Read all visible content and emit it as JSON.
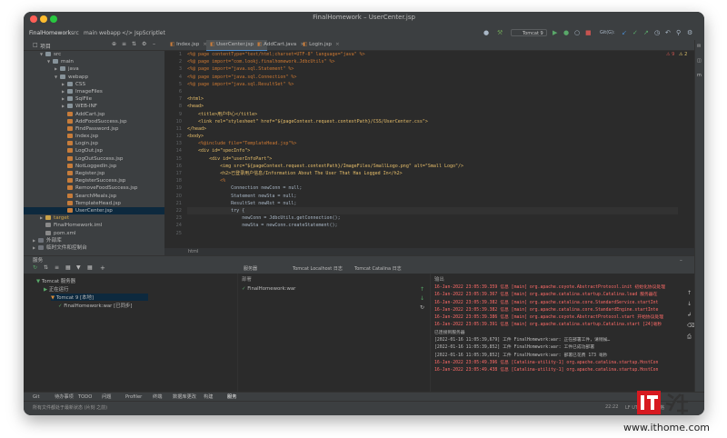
{
  "window": {
    "title": "FinalHomework – UserCenter.jsp"
  },
  "breadcrumb": [
    "FinalHomework",
    "src",
    "main",
    "webapp",
    "</> JspScriptlet"
  ],
  "run_config": "Tomcat 9",
  "project_panel": {
    "label": "项目"
  },
  "tree": [
    {
      "label": "src",
      "indent": 1,
      "kind": "folder",
      "open": true
    },
    {
      "label": "main",
      "indent": 2,
      "kind": "folder",
      "open": true
    },
    {
      "label": "java",
      "indent": 3,
      "kind": "folder",
      "open": false
    },
    {
      "label": "webapp",
      "indent": 3,
      "kind": "folder",
      "open": true
    },
    {
      "label": "CSS",
      "indent": 4,
      "kind": "folder",
      "open": false
    },
    {
      "label": "ImageFiles",
      "indent": 4,
      "kind": "folder",
      "open": false
    },
    {
      "label": "SqlFile",
      "indent": 4,
      "kind": "folder",
      "open": false
    },
    {
      "label": "WEB-INF",
      "indent": 4,
      "kind": "folder",
      "open": false
    },
    {
      "label": "AddCart.jsp",
      "indent": 4,
      "kind": "jsp"
    },
    {
      "label": "AddFoodSuccess.jsp",
      "indent": 4,
      "kind": "jsp"
    },
    {
      "label": "FindPassword.jsp",
      "indent": 4,
      "kind": "jsp"
    },
    {
      "label": "Index.jsp",
      "indent": 4,
      "kind": "jsp"
    },
    {
      "label": "Login.jsp",
      "indent": 4,
      "kind": "jsp"
    },
    {
      "label": "LogOut.jsp",
      "indent": 4,
      "kind": "jsp"
    },
    {
      "label": "LogOutSuccess.jsp",
      "indent": 4,
      "kind": "jsp"
    },
    {
      "label": "NotLoggedIn.jsp",
      "indent": 4,
      "kind": "jsp"
    },
    {
      "label": "Register.jsp",
      "indent": 4,
      "kind": "jsp"
    },
    {
      "label": "RegisterSuccess.jsp",
      "indent": 4,
      "kind": "jsp"
    },
    {
      "label": "RemoveFoodSuccess.jsp",
      "indent": 4,
      "kind": "jsp"
    },
    {
      "label": "SearchMeals.jsp",
      "indent": 4,
      "kind": "jsp"
    },
    {
      "label": "TemplateHead.jsp",
      "indent": 4,
      "kind": "jsp"
    },
    {
      "label": "UserCenter.jsp",
      "indent": 4,
      "kind": "jsp",
      "selected": true
    },
    {
      "label": "target",
      "indent": 1,
      "kind": "folder",
      "open": false,
      "highlight": true
    },
    {
      "label": "FinalHomework.iml",
      "indent": 1,
      "kind": "file"
    },
    {
      "label": "pom.xml",
      "indent": 1,
      "kind": "file"
    },
    {
      "label": "外部库",
      "indent": 0,
      "kind": "lib",
      "open": false
    },
    {
      "label": "临时文件和控制台",
      "indent": 0,
      "kind": "lib",
      "open": false
    }
  ],
  "editor_tabs": [
    {
      "label": "Index.jsp"
    },
    {
      "label": "UserCenter.jsp",
      "active": true
    },
    {
      "label": "AddCart.java"
    },
    {
      "label": "Login.jsp"
    }
  ],
  "line_numbers": [
    "1",
    "2",
    "3",
    "4",
    "5",
    "6",
    "7",
    "8",
    "9",
    "10",
    "11",
    "12",
    "13",
    "14",
    "15",
    "16",
    "17",
    "18",
    "19",
    "20",
    "21",
    "22",
    "23",
    "24",
    "25"
  ],
  "code_lines": [
    "<%@ page contentType=\"text/html;charset=UTF-8\" language=\"java\" %>",
    "<%@ page import=\"com.lookj.finalhomework.JdbcUtils\" %>",
    "<%@ page import=\"java.sql.Statement\" %>",
    "<%@ page import=\"java.sql.Connection\" %>",
    "<%@ page import=\"java.sql.ResultSet\" %>",
    "",
    "<html>",
    "<head>",
    "    <title>用户中心</title>",
    "    <link rel=\"stylesheet\" href=\"${pageContext.request.contextPath}/CSS/UserCenter.css\">",
    "</head>",
    "<body>",
    "    <%@include file=\"TemplateHead.jsp\"%>",
    "    <div id=\"specInfo\">",
    "        <div id=\"userInfoPart\">",
    "            <img src=\"${pageContext.request.contextPath}/ImageFiles/SmallLogo.png\" alt=\"Small Logo\"/>",
    "            <h2>已登录用户信息/Information About The User That Has Logged In</h2>",
    "            <%",
    "                Connection newConn = null;",
    "                Statement newSta = null;",
    "                ResultSet newRst = null;",
    "                try {",
    "                    newConn = JdbcUtils.getConnection();",
    "                    newSta = newConn.createStatement();",
    ""
  ],
  "editor_status": "html",
  "services": {
    "title": "服务",
    "tree": [
      {
        "label": "Tomcat 服务器",
        "indent": 0
      },
      {
        "label": "正在运行",
        "indent": 1
      },
      {
        "label": "Tomcat 9 [本地]",
        "indent": 2
      },
      {
        "label": "FinalHomework:war [已同步]",
        "indent": 3
      }
    ],
    "tabs": [
      "服务器",
      "Tomcat Localhost 日志",
      "Tomcat Catalina 日志"
    ],
    "deploy_header": "部署",
    "deploy_item": "FinalHomework:war",
    "output_header": "输出",
    "log": [
      {
        "text": "16-Jan-2022 23:05:39.359 信息 [main] org.apache.coyote.AbstractProtocol.init 初始化协议处理",
        "color": "red"
      },
      {
        "text": "16-Jan-2022 23:05:39.367 信息 [main] org.apache.catalina.startup.Catalina.load 服务器在",
        "color": "red"
      },
      {
        "text": "16-Jan-2022 23:05:39.382 信息 [main] org.apache.catalina.core.StandardService.startInt",
        "color": "red"
      },
      {
        "text": "16-Jan-2022 23:05:39.382 信息 [main] org.apache.catalina.core.StandardEngine.startInte",
        "color": "red"
      },
      {
        "text": "16-Jan-2022 23:05:39.386 信息 [main] org.apache.coyote.AbstractProtocol.start 开始协议处理",
        "color": "red"
      },
      {
        "text": "16-Jan-2022 23:05:39.391 信息 [main] org.apache.catalina.startup.Catalina.start [24]毫秒",
        "color": "red"
      },
      {
        "text": "已连接到服务器",
        "color": "white"
      },
      {
        "text": "[2022-01-16 11:05:39,679] 工件 FinalHomework:war: 正在部署工件，请稍候…",
        "color": "white"
      },
      {
        "text": "[2022-01-16 11:05:39,852] 工件 FinalHomework:war: 工件已成功部署",
        "color": "white"
      },
      {
        "text": "[2022-01-16 11:05:39,852] 工件 FinalHomework:war: 部署已花费 173 毫秒",
        "color": "white"
      },
      {
        "text": "16-Jan-2022 23:05:49.396 信息 [Catalina-utility-1] org.apache.catalina.startup.HostCon",
        "color": "red"
      },
      {
        "text": "16-Jan-2022 23:05:49.438 信息 [Catalina-utility-1] org.apache.catalina.startup.HostCon",
        "color": "red"
      }
    ]
  },
  "bottom_tools": [
    "Git",
    "待办事项",
    "TODO",
    "问题",
    "Profiler",
    "终端",
    "数据库更改",
    "构建",
    "服务"
  ],
  "status": {
    "message": "所有文件都处于最新状态 (片刻 之前)",
    "caret": "22:22",
    "encoding": "LF  UTF-8  4 个空格"
  },
  "watermark": {
    "logo": "IT之家",
    "url": "www.ithome.com"
  }
}
